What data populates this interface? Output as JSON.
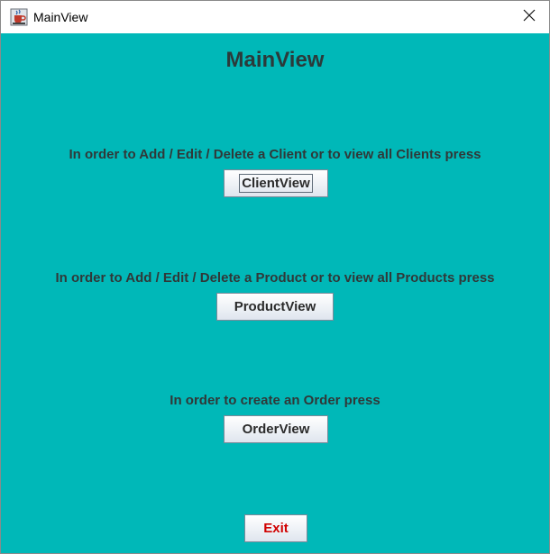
{
  "window": {
    "title": "MainView",
    "icons": {
      "app": "java-cup-icon",
      "close": "close-icon"
    }
  },
  "main": {
    "heading": "MainView",
    "client_text": "In order to Add / Edit / Delete a Client or to view all Clients press",
    "client_button": "ClientView",
    "product_text": "In order to Add / Edit / Delete a Product or to view all Products press",
    "product_button": "ProductView",
    "order_text": "In order to create an Order press",
    "order_button": "OrderView",
    "exit_button": "Exit"
  },
  "colors": {
    "background": "#00b8b8",
    "exit_text": "#d00000"
  }
}
